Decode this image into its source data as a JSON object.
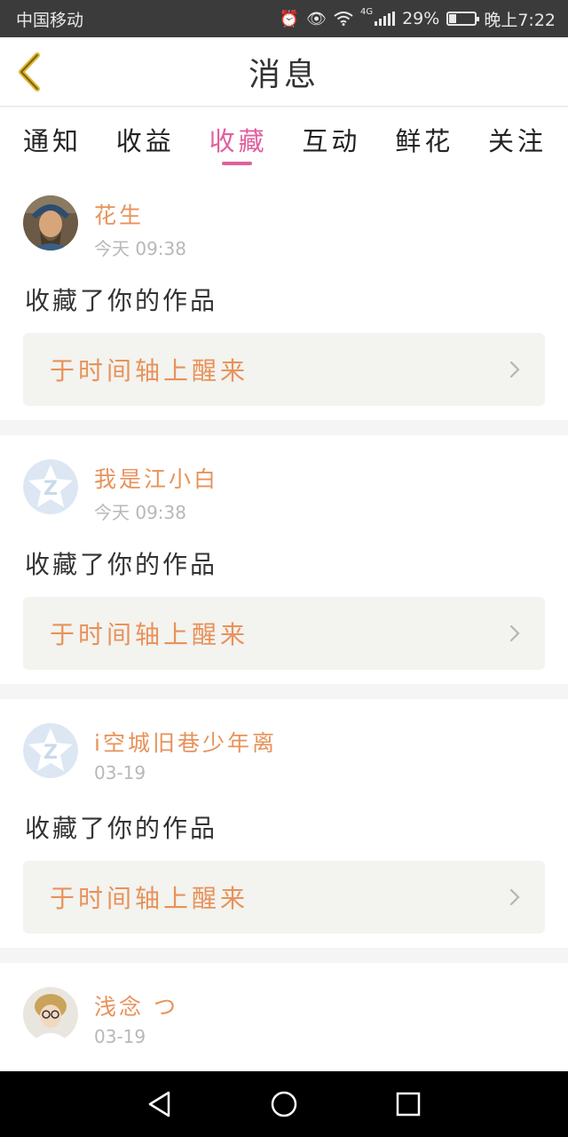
{
  "status_bar": {
    "carrier": "中国移动",
    "network": "4G",
    "battery": "29%",
    "battery_level": 0.29,
    "time": "晚上7:22",
    "icons": [
      "alarm-icon",
      "eye-icon",
      "wifi-icon",
      "signal-icon",
      "battery-icon"
    ]
  },
  "header": {
    "title": "消息",
    "back_icon": "chevron-left-icon"
  },
  "tabs": [
    {
      "label": "通知",
      "active": false
    },
    {
      "label": "收益",
      "active": false
    },
    {
      "label": "收藏",
      "active": true
    },
    {
      "label": "互动",
      "active": false
    },
    {
      "label": "鲜花",
      "active": false
    },
    {
      "label": "关注",
      "active": false
    }
  ],
  "colors": {
    "accent": "#e0609e",
    "name": "#e8925a",
    "time": "#b8b8b8",
    "card_bg": "#f3f3ef"
  },
  "messages": [
    {
      "username": "花生",
      "time": "今天 09:38",
      "action": "收藏了你的作品",
      "work_title": "于时间轴上醒来",
      "avatar": "portrait-avatar"
    },
    {
      "username": "我是江小白",
      "time": "今天 09:38",
      "action": "收藏了你的作品",
      "work_title": "于时间轴上醒来",
      "avatar": "default-avatar"
    },
    {
      "username": "i空城旧巷少年离",
      "time": "03-19",
      "action": "收藏了你的作品",
      "work_title": "于时间轴上醒来",
      "avatar": "default-avatar"
    },
    {
      "username": "浅念 つ",
      "time": "03-19",
      "avatar": "portrait-avatar"
    }
  ],
  "nav_bar": {
    "buttons": [
      "back-triangle-icon",
      "home-circle-icon",
      "recents-square-icon"
    ]
  }
}
